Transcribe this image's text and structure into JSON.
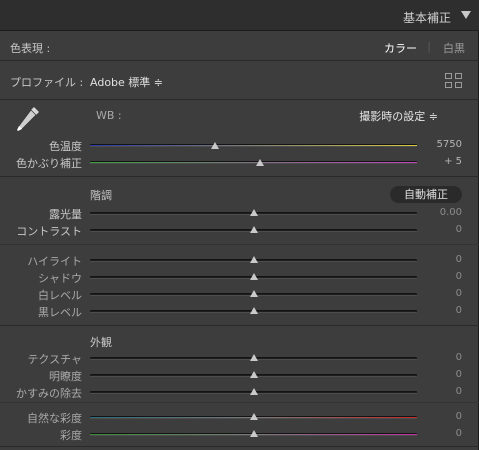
{
  "header": {
    "title": "基本補正"
  },
  "treatment": {
    "label": "色表現 :",
    "color": "カラー",
    "sep": "|",
    "bw": "白黒"
  },
  "profile": {
    "label": "プロファイル :",
    "value": "Adobe 標準 ≑"
  },
  "wb": {
    "label": "WB :",
    "value": "撮影時の設定 ≑"
  },
  "auto_button": "自動補正",
  "groups": {
    "tone": "階調",
    "presence": "外観"
  },
  "sliders": {
    "temp": {
      "label": "色温度",
      "value": "5750",
      "position": 0.38
    },
    "tint": {
      "label": "色かぶり補正",
      "value": "+ 5",
      "position": 0.52
    },
    "exposure": {
      "label": "露光量",
      "value": "0.00",
      "position": 0.5
    },
    "contrast": {
      "label": "コントラスト",
      "value": "0",
      "position": 0.5
    },
    "highlights": {
      "label": "ハイライト",
      "value": "0",
      "position": 0.5
    },
    "shadows": {
      "label": "シャドウ",
      "value": "0",
      "position": 0.5
    },
    "whites": {
      "label": "白レベル",
      "value": "0",
      "position": 0.5
    },
    "blacks": {
      "label": "黒レベル",
      "value": "0",
      "position": 0.5
    },
    "texture": {
      "label": "テクスチャ",
      "value": "0",
      "position": 0.5
    },
    "clarity": {
      "label": "明瞭度",
      "value": "0",
      "position": 0.5
    },
    "dehaze": {
      "label": "かすみの除去",
      "value": "0",
      "position": 0.5
    },
    "vibrance": {
      "label": "自然な彩度",
      "value": "0",
      "position": 0.5
    },
    "saturation": {
      "label": "彩度",
      "value": "0",
      "position": 0.5
    }
  },
  "colors": {
    "temp_gradient": [
      "#2a3aa8",
      "#d8c840"
    ],
    "tint_gradient": [
      "#3aa040",
      "#c040c0"
    ],
    "vibrance_gradient": [
      "#2a6a7a",
      "#c02a2a"
    ],
    "saturation_gradient": [
      "#3a8a3a",
      "#c030a0"
    ]
  }
}
